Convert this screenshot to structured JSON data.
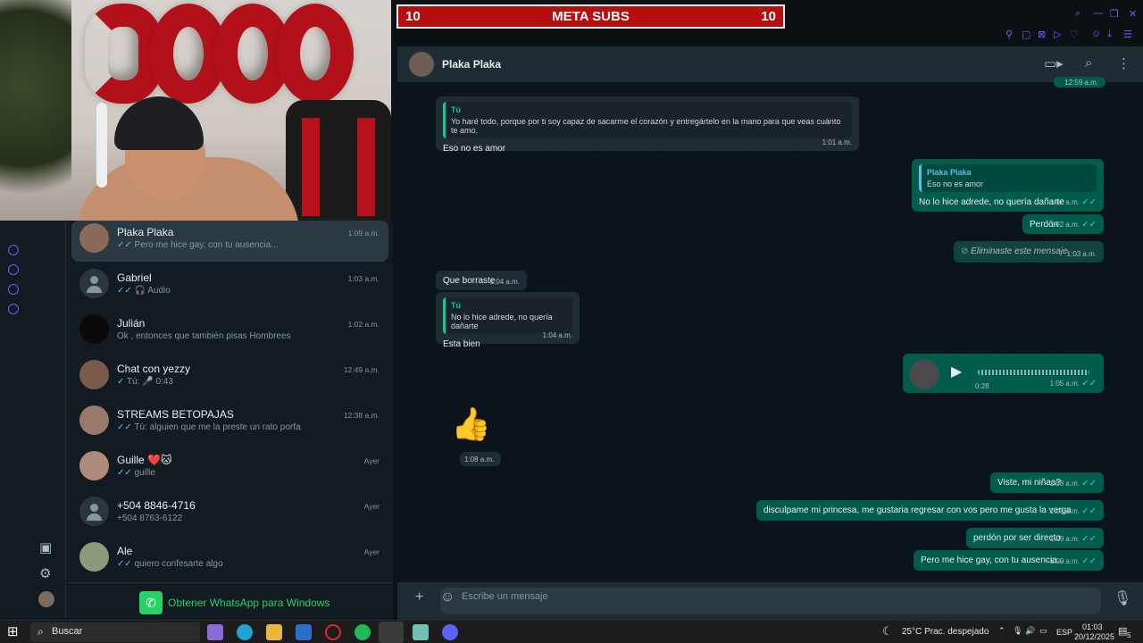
{
  "webcam": {
    "balloon_text": "3000"
  },
  "banner": {
    "left_num": "10",
    "title": "META SUBS",
    "right_num": "10"
  },
  "chat_list": [
    {
      "name": "Plaka Plaka",
      "time": "1:09 a.m.",
      "preview": "Pero me hice gay, con tu ausencia...",
      "tick": "✓✓",
      "active": true
    },
    {
      "name": "Gabriel",
      "time": "1:03 a.m.",
      "preview": "Audio",
      "tick": "✓✓ 🎧",
      "active": false
    },
    {
      "name": "Julián",
      "time": "1:02 a.m.",
      "preview": "Ok , entonces que también pisas Hombrees",
      "tick": "",
      "active": false
    },
    {
      "name": "Chat con yezzy",
      "time": "12:49 a.m.",
      "preview": "Tú: 🎤 0:43",
      "tick": "✓",
      "active": false
    },
    {
      "name": "STREAMS BETOPAJAS",
      "time": "12:38 a.m.",
      "preview": "Tú: alguien que me la preste un rato porfa",
      "tick": "✓✓",
      "active": false
    },
    {
      "name": "Guille ❤️🐱",
      "time": "Ayer",
      "preview": "guille",
      "tick": "✓✓",
      "active": false
    },
    {
      "name": "+504 8846-4716",
      "time": "Ayer",
      "preview": "+504 8763-6122",
      "tick": "",
      "active": false
    },
    {
      "name": "Ale",
      "time": "Ayer",
      "preview": "quiero confesarte algo",
      "tick": "✓✓",
      "active": false
    }
  ],
  "get_app": "Obtener WhatsApp para Windows",
  "chat": {
    "contact": "Plaka Plaka",
    "top_clip_time": "12:59 a.m.",
    "messages": [
      {
        "dir": "in",
        "quote_author": "Tú",
        "quote_text": "Yo haré todo, porque por ti soy capaz de sacarme el corazón y entregártelo en la mano para que veas cuánto te amo.",
        "text": "Eso no es amor",
        "time": "1:01 a.m."
      },
      {
        "dir": "out",
        "quote_author": "Plaka Plaka",
        "quote_text": "Eso no es amor",
        "text": "No lo hice adrede, no quería dañarte",
        "time": "1:02 a.m."
      },
      {
        "dir": "out",
        "text": "Perdón",
        "time": "1:02 a.m."
      },
      {
        "dir": "out",
        "text": "Eliminaste este mensaje.",
        "time": "1:03 a.m."
      },
      {
        "dir": "in",
        "text": "Que borraste",
        "time": "1:04 a.m."
      },
      {
        "dir": "in",
        "quote_author": "Tú",
        "quote_text": "No lo hice adrede, no quería dañarte",
        "text": "Esta bien",
        "time": "1:04 a.m."
      },
      {
        "dir": "out",
        "audio_duration": "0:28",
        "time": "1:05 a.m."
      },
      {
        "dir": "in",
        "emoji": "👍",
        "time": "1:08 a.m."
      },
      {
        "dir": "out",
        "text": "Viste, mi niñaa?",
        "time": "1:08 a.m."
      },
      {
        "dir": "out",
        "text": "disculpame mi princesa, me gustaria regresar con vos pero me gusta la verga",
        "time": "1:08 a.m."
      },
      {
        "dir": "out",
        "text": "perdón por ser directo",
        "time": "1:09 a.m."
      },
      {
        "dir": "out",
        "text": "Pero me hice gay, con tu ausencia...",
        "time": "1:09 a.m."
      }
    ]
  },
  "composer": {
    "placeholder": "Escribe un mensaje"
  },
  "taskbar": {
    "search": "Buscar",
    "weather": "25°C  Prac. despejado",
    "lang": "ESP",
    "time": "01:03",
    "date": "20/12/2025",
    "notif": "5"
  },
  "colors": {
    "accent": "#25d366",
    "out_bubble": "#005c4b",
    "in_bubble": "#202c33",
    "banner": "#b70e0e"
  }
}
